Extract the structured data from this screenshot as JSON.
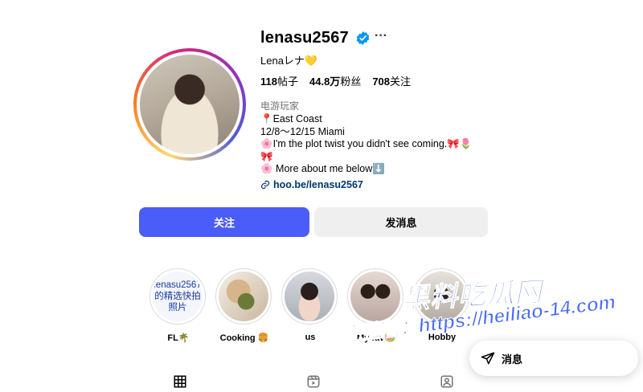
{
  "profile": {
    "username": "lenasu2567",
    "full_name": "Lenaレナ💛",
    "verified_icon": "verified-badge-icon",
    "more_label": "···"
  },
  "stats": {
    "posts_count": "118",
    "posts_label": "帖子",
    "followers_count": "44.8万",
    "followers_label": "粉丝",
    "following_count": "708",
    "following_label": "关注"
  },
  "bio": {
    "category": "电游玩家",
    "line1": "📍East Coast",
    "line2": "12/8～12/15 Miami",
    "line3": "🌸I'm the plot twist you didn't see coming.🎀🌷",
    "line4": "🎀",
    "line5": "🌸 More about me below⬇️",
    "link": "hoo.be/lenasu2567"
  },
  "actions": {
    "follow_label": "关注",
    "message_label": "发消息"
  },
  "highlights": [
    {
      "label": "FL🌴",
      "thumb_text": "lenasu2567的精选快拍照片"
    },
    {
      "label": "Cooking 🍔"
    },
    {
      "label": "us"
    },
    {
      "label": "My fav🍉"
    },
    {
      "label": "Hobby"
    }
  ],
  "watermark": {
    "title": "黑料吃瓜网",
    "url": "看完整版：https://heiliao-14.com"
  },
  "floating_message": {
    "label": "消息"
  },
  "colors": {
    "accent": "#4a5df9",
    "link": "#00376b",
    "muted": "#737373"
  }
}
